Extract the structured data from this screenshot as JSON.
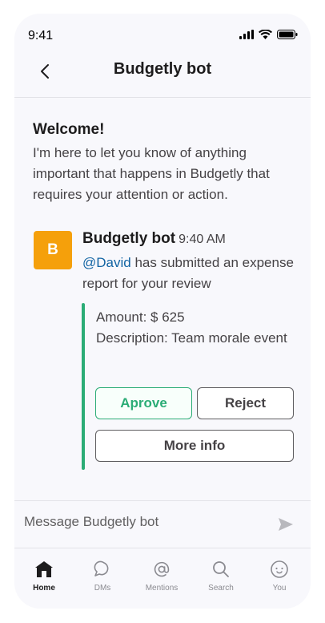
{
  "status_bar": {
    "time": "9:41"
  },
  "header": {
    "title": "Budgetly bot"
  },
  "welcome": {
    "title": "Welcome!",
    "text": "I'm here to let you know of anything important that happens in Budgetly that requires your attention or action."
  },
  "message": {
    "avatar_letter": "B",
    "sender": "Budgetly bot",
    "time": "9:40 AM",
    "mention": "@David",
    "body": " has submitted an expense report for your review",
    "amount": "Amount: $ 625",
    "description": "Description: Team morale event",
    "accent_color": "#2bac76"
  },
  "actions": {
    "approve": "Aprove",
    "reject": "Reject",
    "more_info": "More info"
  },
  "composer": {
    "placeholder": "Message Budgetly bot"
  },
  "tabs": [
    {
      "label": "Home",
      "icon": "home-icon",
      "active": true
    },
    {
      "label": "DMs",
      "icon": "dms-icon",
      "active": false
    },
    {
      "label": "Mentions",
      "icon": "mentions-icon",
      "active": false
    },
    {
      "label": "Search",
      "icon": "search-icon",
      "active": false
    },
    {
      "label": "You",
      "icon": "you-icon",
      "active": false
    }
  ]
}
